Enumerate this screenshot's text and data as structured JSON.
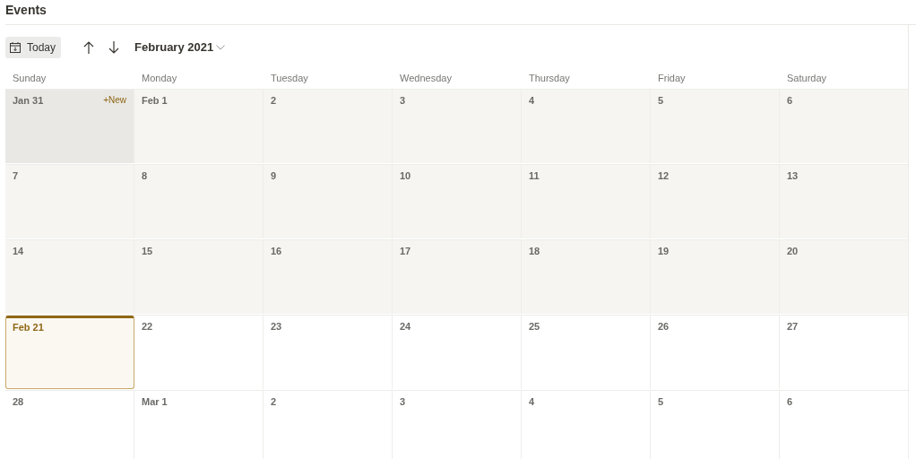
{
  "title": "Events",
  "toolbar": {
    "today_button": "Today",
    "month": "February 2021"
  },
  "weekdays": [
    "Sunday",
    "Monday",
    "Tuesday",
    "Wednesday",
    "Thursday",
    "Friday",
    "Saturday"
  ],
  "weeks": [
    [
      {
        "label": "Jan 31",
        "past": true,
        "hovered": true,
        "today": false,
        "action": "+New"
      },
      {
        "label": "Feb 1",
        "past": true,
        "hovered": false,
        "today": false
      },
      {
        "label": "2",
        "past": true,
        "hovered": false,
        "today": false
      },
      {
        "label": "3",
        "past": true,
        "hovered": false,
        "today": false
      },
      {
        "label": "4",
        "past": true,
        "hovered": false,
        "today": false
      },
      {
        "label": "5",
        "past": true,
        "hovered": false,
        "today": false
      },
      {
        "label": "6",
        "past": true,
        "hovered": false,
        "today": false
      }
    ],
    [
      {
        "label": "7",
        "past": true,
        "hovered": false,
        "today": false
      },
      {
        "label": "8",
        "past": true,
        "hovered": false,
        "today": false
      },
      {
        "label": "9",
        "past": true,
        "hovered": false,
        "today": false
      },
      {
        "label": "10",
        "past": true,
        "hovered": false,
        "today": false
      },
      {
        "label": "11",
        "past": true,
        "hovered": false,
        "today": false
      },
      {
        "label": "12",
        "past": true,
        "hovered": false,
        "today": false
      },
      {
        "label": "13",
        "past": true,
        "hovered": false,
        "today": false
      }
    ],
    [
      {
        "label": "14",
        "past": true,
        "hovered": false,
        "today": false
      },
      {
        "label": "15",
        "past": true,
        "hovered": false,
        "today": false
      },
      {
        "label": "16",
        "past": true,
        "hovered": false,
        "today": false
      },
      {
        "label": "17",
        "past": true,
        "hovered": false,
        "today": false
      },
      {
        "label": "18",
        "past": true,
        "hovered": false,
        "today": false
      },
      {
        "label": "19",
        "past": true,
        "hovered": false,
        "today": false
      },
      {
        "label": "20",
        "past": true,
        "hovered": false,
        "today": false
      }
    ],
    [
      {
        "label": "Feb 21",
        "past": false,
        "hovered": false,
        "today": true
      },
      {
        "label": "22",
        "past": false,
        "hovered": false,
        "today": false
      },
      {
        "label": "23",
        "past": false,
        "hovered": false,
        "today": false
      },
      {
        "label": "24",
        "past": false,
        "hovered": false,
        "today": false
      },
      {
        "label": "25",
        "past": false,
        "hovered": false,
        "today": false
      },
      {
        "label": "26",
        "past": false,
        "hovered": false,
        "today": false
      },
      {
        "label": "27",
        "past": false,
        "hovered": false,
        "today": false
      }
    ],
    [
      {
        "label": "28",
        "past": false,
        "hovered": false,
        "today": false
      },
      {
        "label": "Mar 1",
        "past": false,
        "hovered": false,
        "today": false
      },
      {
        "label": "2",
        "past": false,
        "hovered": false,
        "today": false
      },
      {
        "label": "3",
        "past": false,
        "hovered": false,
        "today": false
      },
      {
        "label": "4",
        "past": false,
        "hovered": false,
        "today": false
      },
      {
        "label": "5",
        "past": false,
        "hovered": false,
        "today": false
      },
      {
        "label": "6",
        "past": false,
        "hovered": false,
        "today": false
      }
    ]
  ]
}
